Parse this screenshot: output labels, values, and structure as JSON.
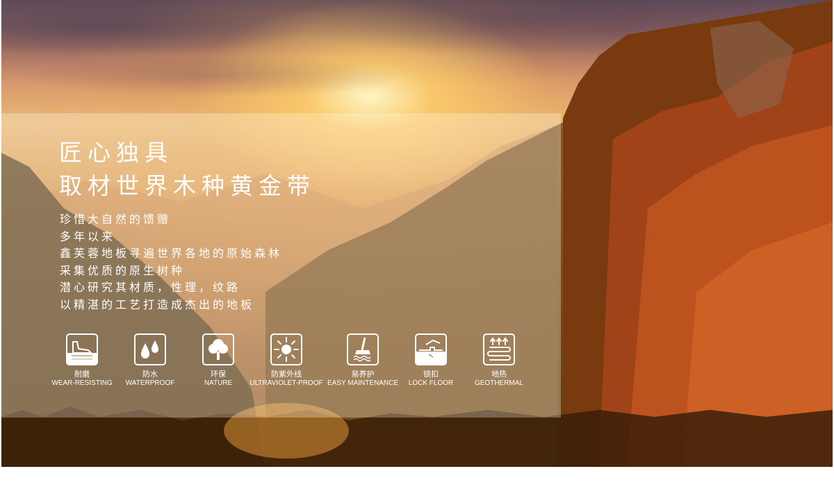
{
  "hero": {
    "headline": [
      "匠心独具",
      "取材世界木种黄金带"
    ],
    "body": [
      "珍惜大自然的馈赠",
      "多年以来",
      "鑫芙蓉地板寻遍世界各地的原始森林",
      "采集优质的原生树种",
      "潜心研究其材质，性理，纹路",
      "以精湛的工艺打造成杰出的地板"
    ]
  },
  "features": [
    {
      "zh": "耐磨",
      "en": "WEAR-RESISTING",
      "icon": "wear-resisting-icon"
    },
    {
      "zh": "防水",
      "en": "WATERPROOF",
      "icon": "waterproof-icon"
    },
    {
      "zh": "环保",
      "en": "NATURE",
      "icon": "nature-tree-icon"
    },
    {
      "zh": "防紫外线",
      "en": "ULTRAVIOLET-PROOF",
      "icon": "sun-icon"
    },
    {
      "zh": "易养护",
      "en": "EASY MAINTENANCE",
      "icon": "mop-icon"
    },
    {
      "zh": "锁扣",
      "en": "LOCK FLOOR",
      "icon": "lock-floor-icon"
    },
    {
      "zh": "地热",
      "en": "GEOTHERMAL",
      "icon": "geothermal-icon"
    }
  ]
}
